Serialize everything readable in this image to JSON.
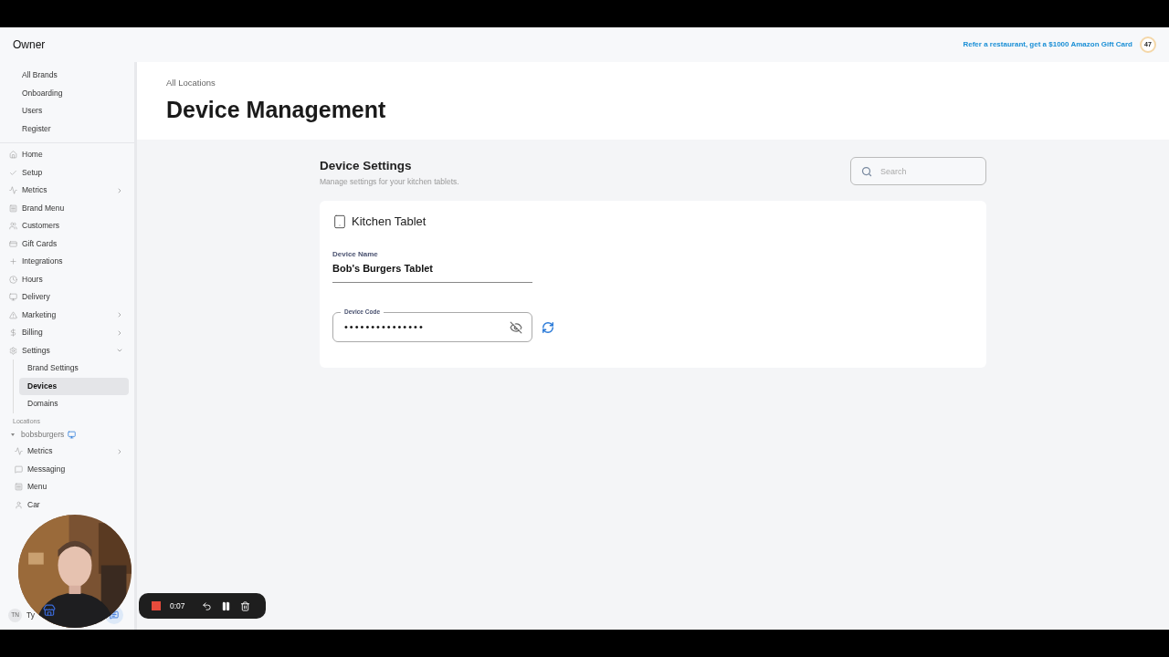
{
  "top_bar": {
    "title": "Owner",
    "referral_link": "Refer a restaurant, get a $1000 Amazon Gift Card",
    "badge": "47"
  },
  "sidebar": {
    "admin_items": [
      {
        "label": "All Brands",
        "selected": false
      },
      {
        "label": "Onboarding",
        "selected": false
      },
      {
        "label": "Users",
        "selected": false
      },
      {
        "label": "Register",
        "selected": false
      }
    ],
    "nav_items": [
      {
        "label": "Home",
        "kind": "home"
      },
      {
        "label": "Setup",
        "kind": "check"
      },
      {
        "label": "Metrics",
        "kind": "metrics",
        "expanded": false
      },
      {
        "label": "Brand Menu",
        "kind": "menu"
      },
      {
        "label": "Customers",
        "kind": "users"
      },
      {
        "label": "Gift Cards",
        "kind": "card"
      },
      {
        "label": "Integrations",
        "kind": "plus"
      },
      {
        "label": "Hours",
        "kind": "clock"
      },
      {
        "label": "Delivery",
        "kind": "monitor"
      },
      {
        "label": "Marketing",
        "kind": "triangle",
        "expanded": false
      },
      {
        "label": "Billing",
        "kind": "dollar",
        "expanded": false
      },
      {
        "label": "Settings",
        "kind": "gear",
        "expanded": true,
        "children": [
          {
            "label": "Brand Settings",
            "selected": false
          },
          {
            "label": "Devices",
            "selected": true
          },
          {
            "label": "Domains",
            "selected": false
          }
        ]
      }
    ],
    "locations_label": "Locations",
    "location": {
      "name": "bobsburgers",
      "expanded": true,
      "items": [
        {
          "label": "Metrics",
          "kind": "metrics",
          "expanded": false
        },
        {
          "label": "Messaging",
          "kind": "message"
        },
        {
          "label": "Menu",
          "kind": "menu"
        },
        {
          "label": "Car",
          "kind": "user"
        }
      ]
    },
    "user": {
      "initials": "TN",
      "name": "Ty"
    }
  },
  "main": {
    "breadcrumb": "All Locations",
    "title": "Device Management",
    "section_title": "Device Settings",
    "section_subtitle": "Manage settings for your kitchen tablets.",
    "search": {
      "placeholder": "Search"
    },
    "device": {
      "title": "Kitchen Tablet",
      "name_label": "Device Name",
      "name_value": "Bob's Burgers Tablet",
      "code_label": "Device Code",
      "code_value": "•••••••••••••••"
    }
  },
  "recorder": {
    "time": "0:07"
  }
}
